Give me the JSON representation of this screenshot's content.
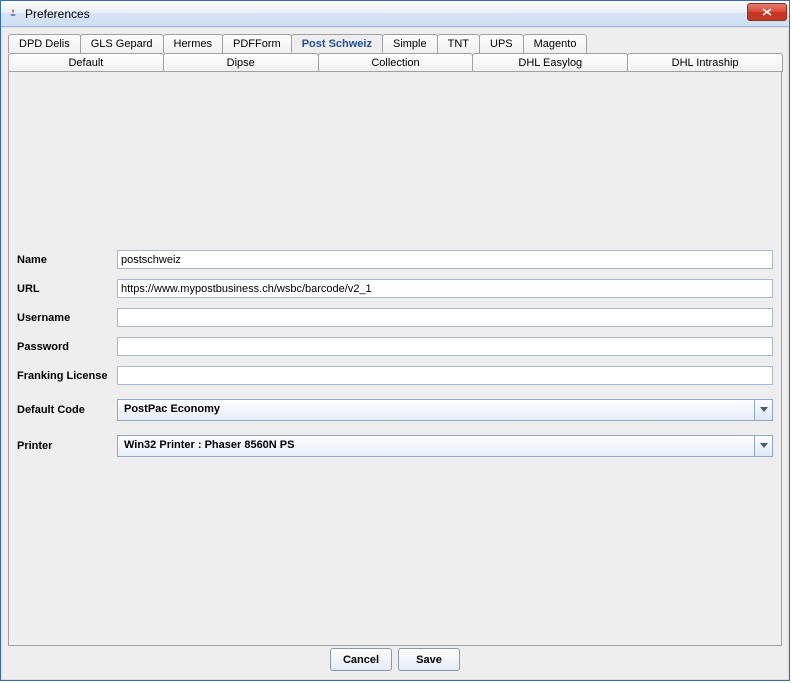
{
  "window": {
    "title": "Preferences"
  },
  "tabs_row1": [
    {
      "label": "DPD Delis"
    },
    {
      "label": "GLS Gepard"
    },
    {
      "label": "Hermes"
    },
    {
      "label": "PDFForm"
    },
    {
      "label": "Post Schweiz",
      "selected": true
    },
    {
      "label": "Simple"
    },
    {
      "label": "TNT"
    },
    {
      "label": "UPS"
    },
    {
      "label": "Magento"
    }
  ],
  "tabs_row2": [
    {
      "label": "Default"
    },
    {
      "label": "Dipse"
    },
    {
      "label": "Collection"
    },
    {
      "label": "DHL Easylog"
    },
    {
      "label": "DHL Intraship"
    }
  ],
  "form": {
    "name_label": "Name",
    "name_value": "postschweiz",
    "url_label": "URL",
    "url_value": "https://www.mypostbusiness.ch/wsbc/barcode/v2_1",
    "username_label": "Username",
    "username_value": "",
    "password_label": "Password",
    "password_value": "",
    "franking_label": "Franking License",
    "franking_value": "",
    "defaultcode_label": "Default Code",
    "defaultcode_value": "PostPac Economy",
    "printer_label": "Printer",
    "printer_value": "Win32 Printer : Phaser 8560N PS"
  },
  "buttons": {
    "cancel": "Cancel",
    "save": "Save"
  }
}
